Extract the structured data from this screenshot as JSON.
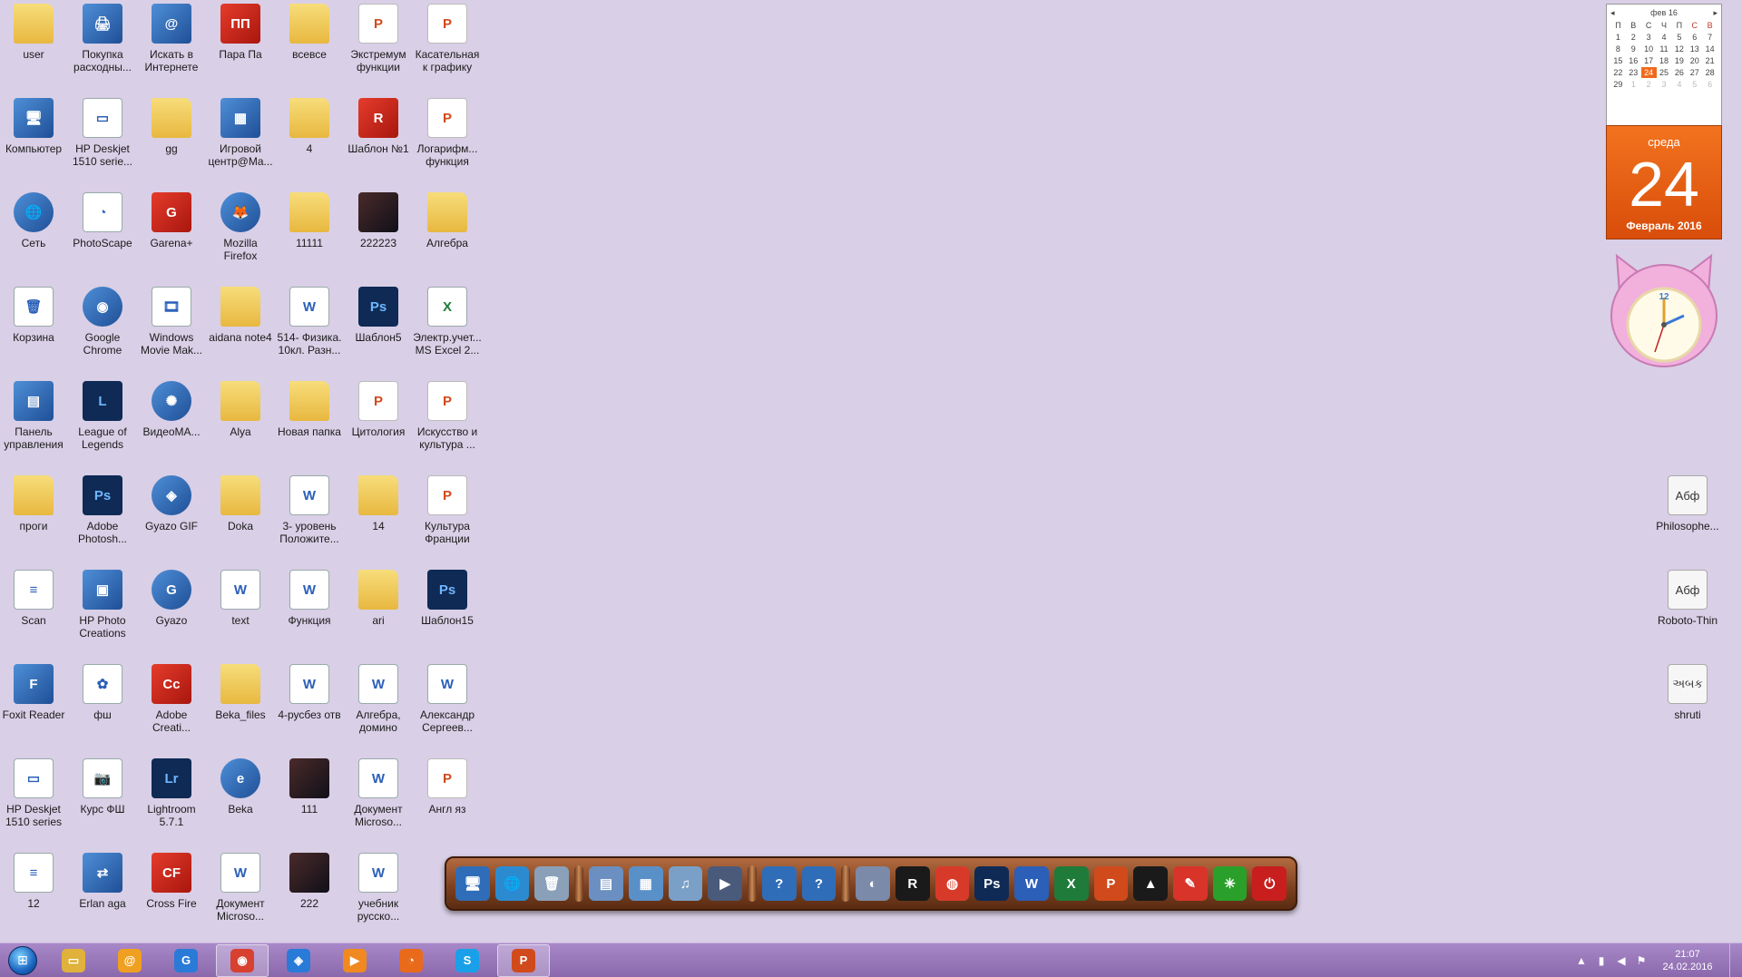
{
  "desktop": {
    "icons": [
      {
        "label": "user",
        "icon": "user-folder-icon",
        "kind": "folder",
        "glyph": ""
      },
      {
        "label": "Покупка расходны...",
        "icon": "printer-shop-icon",
        "kind": "app",
        "glyph": "🖨"
      },
      {
        "label": "Искать в Интернете",
        "icon": "mail-search-icon",
        "kind": "app",
        "glyph": "@"
      },
      {
        "label": "Пара Па",
        "icon": "para-pa-icon",
        "kind": "red",
        "glyph": "ПП"
      },
      {
        "label": "всевсе",
        "icon": "folder-icon",
        "kind": "folder",
        "glyph": ""
      },
      {
        "label": "Экстремум функции",
        "icon": "ppt-file-icon",
        "kind": "ppt",
        "glyph": "P"
      },
      {
        "label": "Касательная к графику",
        "icon": "ppt-file-icon",
        "kind": "ppt",
        "glyph": "P"
      },
      {
        "label": "Компьютер",
        "icon": "computer-icon",
        "kind": "app",
        "glyph": "🖥"
      },
      {
        "label": "HP Deskjet 1510 serie...",
        "icon": "scanner-icon",
        "kind": "doc",
        "glyph": "▭"
      },
      {
        "label": "gg",
        "icon": "folder-icon",
        "kind": "folder",
        "glyph": ""
      },
      {
        "label": "Игровой центр@Ma...",
        "icon": "game-center-icon",
        "kind": "app",
        "glyph": "▦"
      },
      {
        "label": "4",
        "icon": "folder-icon",
        "kind": "folder",
        "glyph": ""
      },
      {
        "label": "Шаблон №1",
        "icon": "winrar-icon",
        "kind": "red",
        "glyph": "R"
      },
      {
        "label": "Логарифм... функция",
        "icon": "ppt-file-icon",
        "kind": "ppt",
        "glyph": "P"
      },
      {
        "label": "Сеть",
        "icon": "network-icon",
        "kind": "round",
        "glyph": "🌐"
      },
      {
        "label": "PhotoScape",
        "icon": "photoscape-icon",
        "kind": "doc",
        "glyph": "◔"
      },
      {
        "label": "Garena+",
        "icon": "garena-icon",
        "kind": "red",
        "glyph": "G"
      },
      {
        "label": "Mozilla Firefox",
        "icon": "firefox-icon",
        "kind": "round",
        "glyph": "🦊"
      },
      {
        "label": "11111",
        "icon": "folder-icon",
        "kind": "folder",
        "glyph": ""
      },
      {
        "label": "222223",
        "icon": "image-file-icon",
        "kind": "img",
        "glyph": ""
      },
      {
        "label": "Алгебра",
        "icon": "folder-icon",
        "kind": "folder",
        "glyph": ""
      },
      {
        "label": "Корзина",
        "icon": "recycle-bin-icon",
        "kind": "doc",
        "glyph": "🗑"
      },
      {
        "label": "Google Chrome",
        "icon": "chrome-icon",
        "kind": "round",
        "glyph": "◉"
      },
      {
        "label": "Windows Movie Mak...",
        "icon": "movie-maker-icon",
        "kind": "doc",
        "glyph": "🎞"
      },
      {
        "label": "aidana note4",
        "icon": "folder-icon",
        "kind": "folder",
        "glyph": ""
      },
      {
        "label": "514- Физика. 10кл. Разн...",
        "icon": "word-file-icon",
        "kind": "word",
        "glyph": "W"
      },
      {
        "label": "Шаблон5",
        "icon": "psd-file-icon",
        "kind": "ps",
        "glyph": "Ps"
      },
      {
        "label": "Электр.учет... MS Excel 2...",
        "icon": "excel-file-icon",
        "kind": "xl",
        "glyph": "X"
      },
      {
        "label": "Панель управления",
        "icon": "control-panel-icon",
        "kind": "app",
        "glyph": "▤"
      },
      {
        "label": "League of Legends",
        "icon": "league-icon",
        "kind": "ps",
        "glyph": "L"
      },
      {
        "label": "ВидеоМА...",
        "icon": "videomaster-icon",
        "kind": "round",
        "glyph": "✺"
      },
      {
        "label": "Alya",
        "icon": "folder-icon",
        "kind": "folder",
        "glyph": ""
      },
      {
        "label": "Новая папка",
        "icon": "folder-icon",
        "kind": "folder",
        "glyph": ""
      },
      {
        "label": "Цитология",
        "icon": "ppt-file-icon",
        "kind": "ppt",
        "glyph": "P"
      },
      {
        "label": "Искусство и культура ...",
        "icon": "ppt-file-icon",
        "kind": "ppt",
        "glyph": "P"
      },
      {
        "label": "проги",
        "icon": "folder-icon",
        "kind": "folder",
        "glyph": ""
      },
      {
        "label": "Adobe Photosh...",
        "icon": "photoshop-icon",
        "kind": "ps",
        "glyph": "Ps"
      },
      {
        "label": "Gyazo GIF",
        "icon": "gyazo-gif-icon",
        "kind": "round",
        "glyph": "◈"
      },
      {
        "label": "Doka",
        "icon": "folder-icon",
        "kind": "folder",
        "glyph": ""
      },
      {
        "label": "3- уровень Положите...",
        "icon": "word-file-icon",
        "kind": "word",
        "glyph": "W"
      },
      {
        "label": "14",
        "icon": "folder-icon",
        "kind": "folder",
        "glyph": ""
      },
      {
        "label": "Культура Франции",
        "icon": "ppt-file-icon",
        "kind": "ppt",
        "glyph": "P"
      },
      {
        "label": "Scan",
        "icon": "scan-file-icon",
        "kind": "doc",
        "glyph": "≡"
      },
      {
        "label": "HP Photo Creations",
        "icon": "hp-photo-icon",
        "kind": "app",
        "glyph": "▣"
      },
      {
        "label": "Gyazo",
        "icon": "gyazo-icon",
        "kind": "round",
        "glyph": "G"
      },
      {
        "label": "text",
        "icon": "word-file-icon",
        "kind": "word",
        "glyph": "W"
      },
      {
        "label": "Функция",
        "icon": "word-file-icon",
        "kind": "word",
        "glyph": "W"
      },
      {
        "label": "ari",
        "icon": "folder-icon",
        "kind": "folder",
        "glyph": ""
      },
      {
        "label": "Шаблон15",
        "icon": "psd-file-icon",
        "kind": "ps",
        "glyph": "Ps"
      },
      {
        "label": "Foxit Reader",
        "icon": "foxit-icon",
        "kind": "app",
        "glyph": "F"
      },
      {
        "label": "фш",
        "icon": "msn-butterfly-icon",
        "kind": "doc",
        "glyph": "✿"
      },
      {
        "label": "Adobe Creati...",
        "icon": "adobe-cc-icon",
        "kind": "red",
        "glyph": "Cc"
      },
      {
        "label": "Beka_files",
        "icon": "folder-icon",
        "kind": "folder",
        "glyph": ""
      },
      {
        "label": "4-русбез отв",
        "icon": "word-file-icon",
        "kind": "word",
        "glyph": "W"
      },
      {
        "label": "Алгебра, домино",
        "icon": "word-file-icon",
        "kind": "word",
        "glyph": "W"
      },
      {
        "label": "Александр Сергеев...",
        "icon": "word-file-icon",
        "kind": "word",
        "glyph": "W"
      },
      {
        "label": "HP Deskjet 1510 series",
        "icon": "scanner-icon",
        "kind": "doc",
        "glyph": "▭"
      },
      {
        "label": "Курс ФШ",
        "icon": "camera-icon",
        "kind": "doc",
        "glyph": "📷"
      },
      {
        "label": "Lightroom 5.7.1",
        "icon": "lightroom-icon",
        "kind": "ps",
        "glyph": "Lr"
      },
      {
        "label": "Beka",
        "icon": "ie-icon",
        "kind": "round",
        "glyph": "e"
      },
      {
        "label": "111",
        "icon": "image-file-icon",
        "kind": "img",
        "glyph": ""
      },
      {
        "label": "Документ Microso...",
        "icon": "word-file-icon",
        "kind": "word",
        "glyph": "W"
      },
      {
        "label": "Англ яз",
        "icon": "ppt-file-icon",
        "kind": "ppt",
        "glyph": "P"
      },
      {
        "label": "12",
        "icon": "text-file-icon",
        "kind": "doc",
        "glyph": "≡"
      },
      {
        "label": "Erlan aga",
        "icon": "sync-arrows-icon",
        "kind": "app",
        "glyph": "⇄"
      },
      {
        "label": "Cross Fire",
        "icon": "crossfire-icon",
        "kind": "red",
        "glyph": "CF"
      },
      {
        "label": "Документ Microso...",
        "icon": "word-file-icon",
        "kind": "word",
        "glyph": "W"
      },
      {
        "label": "222",
        "icon": "image-file-icon",
        "kind": "img",
        "glyph": ""
      },
      {
        "label": "учебник русско...",
        "icon": "word-file-icon",
        "kind": "word",
        "glyph": "W"
      }
    ],
    "font_files": [
      {
        "label": "Philosophe...",
        "preview": "Абф",
        "icon": "font-file-icon"
      },
      {
        "label": "Roboto-Thin",
        "preview": "Абф",
        "icon": "font-file-icon"
      },
      {
        "label": "shruti",
        "preview": "અબક",
        "icon": "font-file-icon"
      }
    ]
  },
  "calendar_gadget": {
    "month_header": "фев 16",
    "weekdays": [
      "П",
      "В",
      "С",
      "Ч",
      "П",
      "С",
      "В"
    ],
    "days": [
      "1",
      "2",
      "3",
      "4",
      "5",
      "6",
      "7",
      "8",
      "9",
      "10",
      "11",
      "12",
      "13",
      "14",
      "15",
      "16",
      "17",
      "18",
      "19",
      "20",
      "21",
      "22",
      "23",
      "24",
      "25",
      "26",
      "27",
      "28",
      "29",
      "1",
      "2",
      "3",
      "4",
      "5",
      "6"
    ],
    "today": "24",
    "weekday_name": "среда",
    "day_number": "24",
    "month_year": "Февраль 2016"
  },
  "clock_gadget": {
    "icon": "pink-cat-clock-icon",
    "hour_label": "12"
  },
  "dock": {
    "items": [
      {
        "icon": "computer-icon",
        "glyph": "🖥",
        "color": "#2f6db8"
      },
      {
        "icon": "network-icon",
        "glyph": "🌐",
        "color": "#2c8bd0"
      },
      {
        "icon": "recycle-bin-icon",
        "glyph": "🗑",
        "color": "#8aa0b8"
      },
      {
        "icon": "separator",
        "glyph": "",
        "color": ""
      },
      {
        "icon": "documents-icon",
        "glyph": "▤",
        "color": "#6a8fc0"
      },
      {
        "icon": "pictures-icon",
        "glyph": "▦",
        "color": "#5a90c8"
      },
      {
        "icon": "music-icon",
        "glyph": "♫",
        "color": "#7aa0c8"
      },
      {
        "icon": "video-icon",
        "glyph": "▶",
        "color": "#4a5a7a"
      },
      {
        "icon": "separator",
        "glyph": "",
        "color": ""
      },
      {
        "icon": "help-icon",
        "glyph": "?",
        "color": "#2f6db8"
      },
      {
        "icon": "help-icon",
        "glyph": "?",
        "color": "#2f6db8"
      },
      {
        "icon": "separator",
        "glyph": "",
        "color": ""
      },
      {
        "icon": "disc-icon",
        "glyph": "◐",
        "color": "#7a8aa8"
      },
      {
        "icon": "rockstar-icon",
        "glyph": "R",
        "color": "#1a1a1a"
      },
      {
        "icon": "chart-app-icon",
        "glyph": "◍",
        "color": "#d83a2a"
      },
      {
        "icon": "photoshop-icon",
        "glyph": "Ps",
        "color": "#0e2a55"
      },
      {
        "icon": "word-icon",
        "glyph": "W",
        "color": "#2b5fb8"
      },
      {
        "icon": "excel-icon",
        "glyph": "X",
        "color": "#1e7b3a"
      },
      {
        "icon": "powerpoint-icon",
        "glyph": "P",
        "color": "#d04a1c"
      },
      {
        "icon": "warning-app-icon",
        "glyph": "▲",
        "color": "#1a1a1a"
      },
      {
        "icon": "brush-app-icon",
        "glyph": "✎",
        "color": "#d8342a"
      },
      {
        "icon": "utorrent-icon",
        "glyph": "✳",
        "color": "#2aa02a"
      },
      {
        "icon": "power-icon",
        "glyph": "⏻",
        "color": "#c81e1e"
      }
    ]
  },
  "taskbar": {
    "start_icon": "windows-start-icon",
    "items": [
      {
        "icon": "explorer-icon",
        "glyph": "▭",
        "color": "#e0b23c",
        "active": false
      },
      {
        "icon": "mail-agent-icon",
        "glyph": "@",
        "color": "#f0a020",
        "active": false
      },
      {
        "icon": "gyazo-icon",
        "glyph": "G",
        "color": "#2a7ad8",
        "active": false
      },
      {
        "icon": "chrome-icon",
        "glyph": "◉",
        "color": "#d84030",
        "active": true
      },
      {
        "icon": "gyazo-gif-icon",
        "glyph": "◈",
        "color": "#2a7ad8",
        "active": false
      },
      {
        "icon": "media-player-icon",
        "glyph": "▶",
        "color": "#f08a20",
        "active": false
      },
      {
        "icon": "firefox-icon",
        "glyph": "◔",
        "color": "#e86a1a",
        "active": false
      },
      {
        "icon": "skype-icon",
        "glyph": "S",
        "color": "#1aa0e8",
        "active": false
      },
      {
        "icon": "powerpoint-icon",
        "glyph": "P",
        "color": "#d04a1c",
        "active": true
      }
    ],
    "tray": {
      "icons": [
        "show-hidden-icon",
        "network-signal-icon",
        "volume-icon",
        "action-center-flag-icon"
      ],
      "glyphs": [
        "▲",
        "▮",
        "◀",
        "⚑"
      ],
      "time": "21:07",
      "date": "24.02.2016"
    }
  }
}
